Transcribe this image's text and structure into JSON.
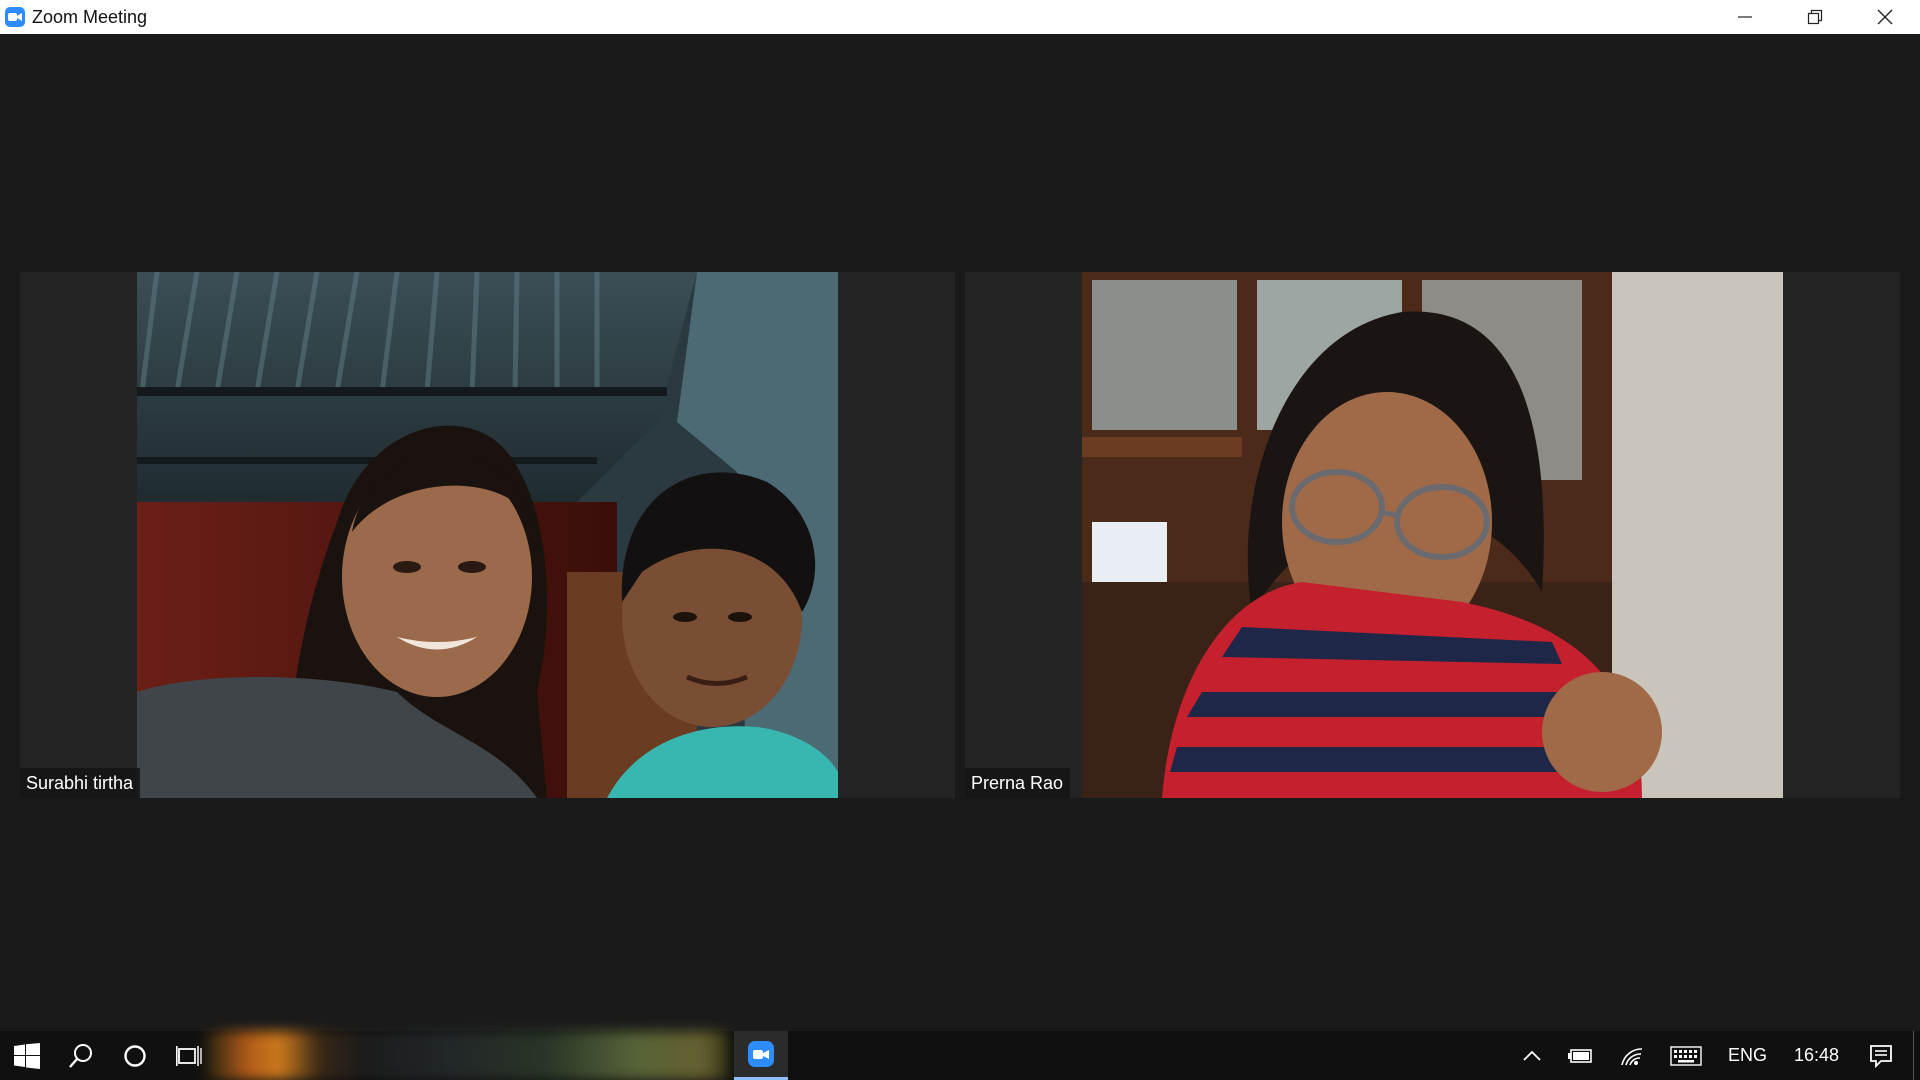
{
  "window": {
    "title": "Zoom Meeting",
    "icon": "zoom-camera-icon",
    "controls": [
      "minimize-icon",
      "restore-icon",
      "close-icon"
    ]
  },
  "participants": [
    {
      "name": "Surabhi tirtha"
    },
    {
      "name": "Prerna Rao"
    }
  ],
  "taskbar": {
    "icons": [
      "windows-start-icon",
      "search-icon",
      "cortana-icon",
      "task-view-icon",
      "zoom-app-icon"
    ],
    "tray": {
      "icons": [
        "chevron-up-icon",
        "battery-icon",
        "wifi-icon",
        "keyboard-icon",
        "notifications-icon"
      ],
      "language": "ENG",
      "time": "16:48"
    }
  },
  "colors": {
    "meeting_bg": "#1a1a1a",
    "zoom_blue": "#2d8cff",
    "taskbar_bg": "#101010"
  }
}
